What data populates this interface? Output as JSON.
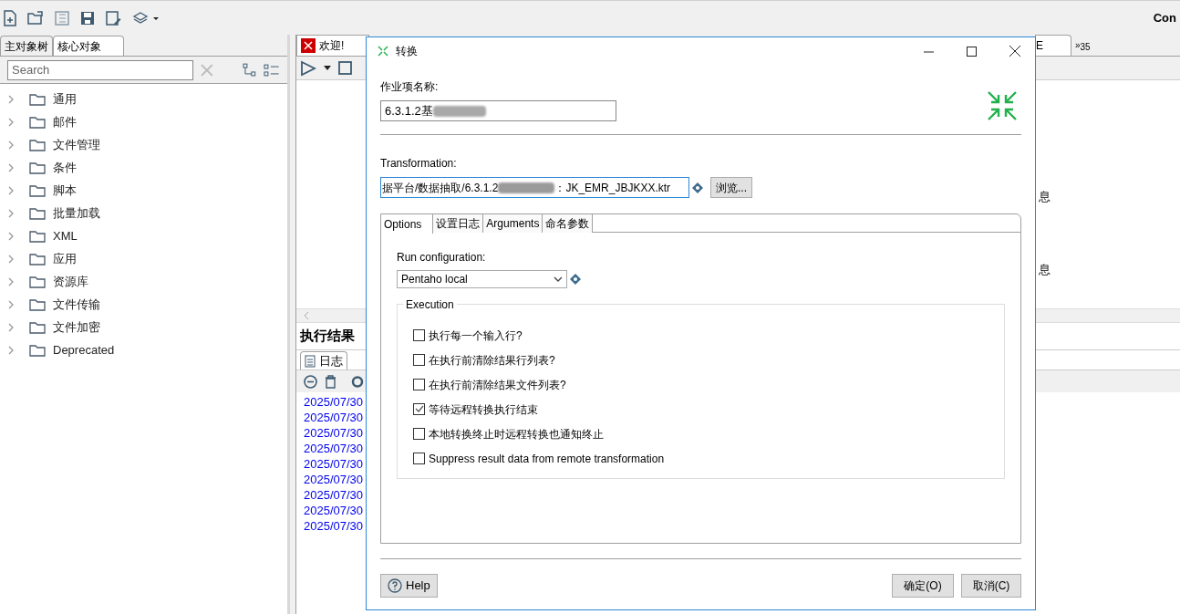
{
  "toolbar": {
    "right_text": "Con"
  },
  "left_panel": {
    "tabs": [
      {
        "label": "主对象树",
        "selected": false
      },
      {
        "label": "核心对象",
        "selected": true
      }
    ],
    "search": {
      "placeholder": "Search"
    },
    "tree": [
      {
        "label": "通用",
        "expanded": false
      },
      {
        "label": "邮件",
        "expanded": false
      },
      {
        "label": "文件管理",
        "expanded": false
      },
      {
        "label": "条件",
        "expanded": false
      },
      {
        "label": "脚本",
        "expanded": false
      },
      {
        "label": "批量加载",
        "expanded": false
      },
      {
        "label": "XML",
        "expanded": false
      },
      {
        "label": "应用",
        "expanded": false
      },
      {
        "label": "资源库",
        "expanded": false
      },
      {
        "label": "文件传输",
        "expanded": false
      },
      {
        "label": "文件加密",
        "expanded": false
      },
      {
        "label": "Deprecated",
        "expanded": false
      }
    ]
  },
  "main": {
    "tabs": [
      {
        "label": "欢迎!"
      },
      {
        "label": "E"
      },
      {
        "label": "»",
        "count": "35"
      }
    ],
    "canvas_text": [
      "息",
      "息"
    ],
    "results_title": "执行结果",
    "results_tab": "日志",
    "log_lines": [
      "2025/07/30",
      "2025/07/30",
      "2025/07/30",
      "2025/07/30",
      "2025/07/30",
      "2025/07/30",
      "2025/07/30",
      "2025/07/30",
      "2025/07/30"
    ]
  },
  "dialog": {
    "title": "转换",
    "name_label": "作业项名称:",
    "name_value": "6.3.1.2基",
    "transformation_label": "Transformation:",
    "transformation_prefix": "据平台/数据抽取/6.3.1.2",
    "transformation_suffix": "：JK_EMR_JBJKXX.ktr",
    "browse_button": "浏览...",
    "tabs": [
      {
        "label": "Options",
        "selected": true
      },
      {
        "label": "设置日志",
        "selected": false
      },
      {
        "label": "Arguments",
        "selected": false
      },
      {
        "label": "命名参数",
        "selected": false
      }
    ],
    "run_config_label": "Run configuration:",
    "run_config_value": "Pentaho local",
    "execution_title": "Execution",
    "options": [
      {
        "label": "执行每一个输入行?",
        "checked": false
      },
      {
        "label": "在执行前清除结果行列表?",
        "checked": false
      },
      {
        "label": "在执行前清除结果文件列表?",
        "checked": false
      },
      {
        "label": "等待远程转换执行结束",
        "checked": true
      },
      {
        "label": "本地转换终止时远程转换也通知终止",
        "checked": false
      },
      {
        "label": "Suppress result data from remote transformation",
        "checked": false
      }
    ],
    "help_button": "Help",
    "ok_button": "确定(O)",
    "cancel_button": "取消(C)"
  }
}
